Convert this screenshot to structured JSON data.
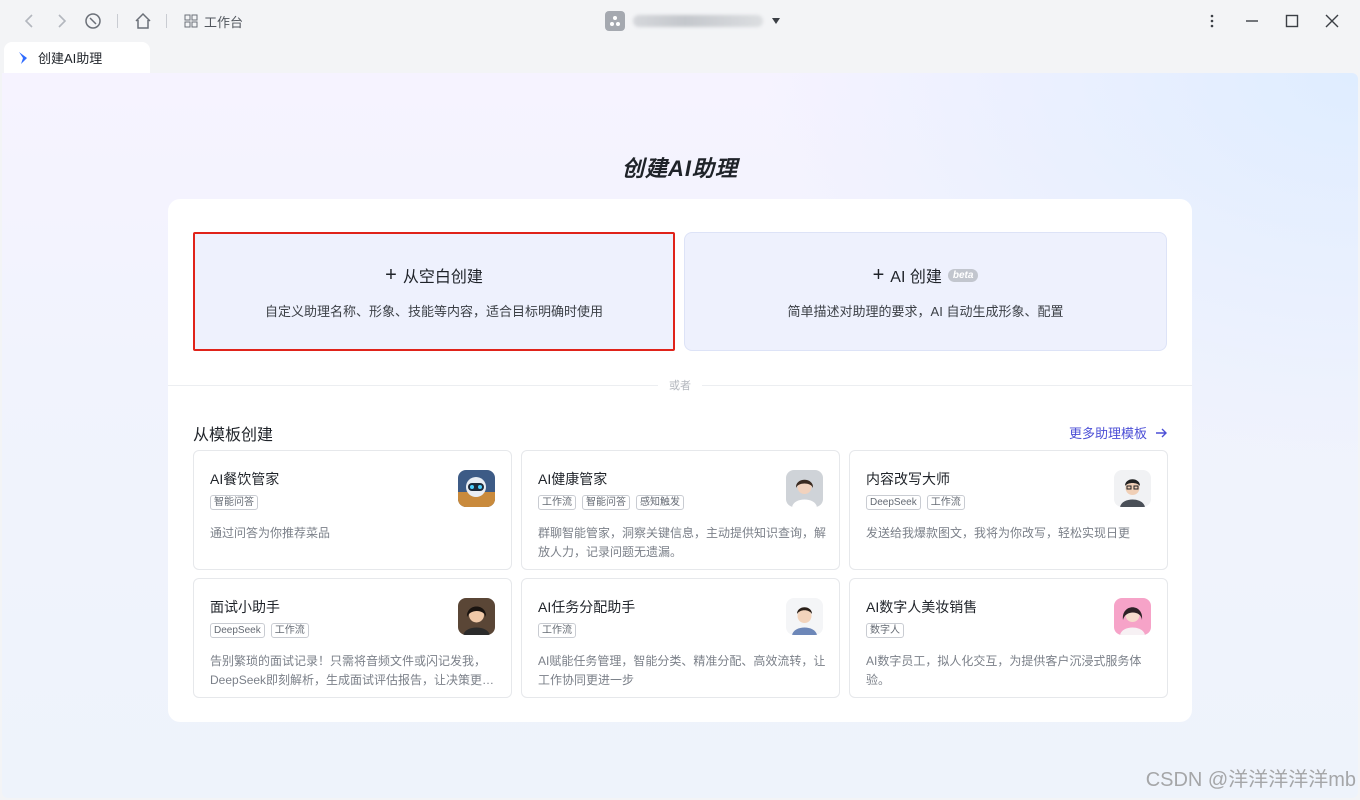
{
  "titlebar": {
    "workbench_label": "工作台"
  },
  "tab": {
    "label": "创建AI助理"
  },
  "page": {
    "title": "创建AI助理"
  },
  "blank_card": {
    "title": "从空白创建",
    "desc": "自定义助理名称、形象、技能等内容，适合目标明确时使用"
  },
  "ai_card": {
    "title": "AI 创建",
    "badge": "beta",
    "desc": "简单描述对助理的要求，AI 自动生成形象、配置"
  },
  "divider_label": "或者",
  "templates_section": {
    "title": "从模板创建",
    "more_link": "更多助理模板"
  },
  "templates": [
    {
      "name": "AI餐饮管家",
      "tags": [
        "智能问答"
      ],
      "desc": "通过问答为你推荐菜品",
      "avatar": "robot-avatar"
    },
    {
      "name": "AI健康管家",
      "tags": [
        "工作流",
        "智能问答",
        "感知触发"
      ],
      "desc": "群聊智能管家，洞察关键信息，主动提供知识查询，解放人力，记录问题无遗漏。",
      "avatar": "doctor-avatar"
    },
    {
      "name": "内容改写大师",
      "tags": [
        "DeepSeek",
        "工作流"
      ],
      "desc": "发送给我爆款图文，我将为你改写，轻松实现日更",
      "avatar": "writer-avatar"
    },
    {
      "name": "面试小助手",
      "tags": [
        "DeepSeek",
        "工作流"
      ],
      "desc": "告别繁琐的面试记录！只需将音频文件或闪记发我，DeepSeek即刻解析，生成面试评估报告，让决策更…",
      "avatar": "interviewer-avatar"
    },
    {
      "name": "AI任务分配助手",
      "tags": [
        "工作流"
      ],
      "desc": "AI赋能任务管理，智能分类、精准分配、高效流转，让工作协同更进一步",
      "avatar": "assistant-avatar"
    },
    {
      "name": "AI数字人美妆销售",
      "tags": [
        "数字人"
      ],
      "desc": "AI数字员工，拟人化交互，为提供客户沉浸式服务体验。",
      "avatar": "sales-avatar"
    }
  ],
  "watermark": "CSDN @洋洋洋洋洋mb"
}
